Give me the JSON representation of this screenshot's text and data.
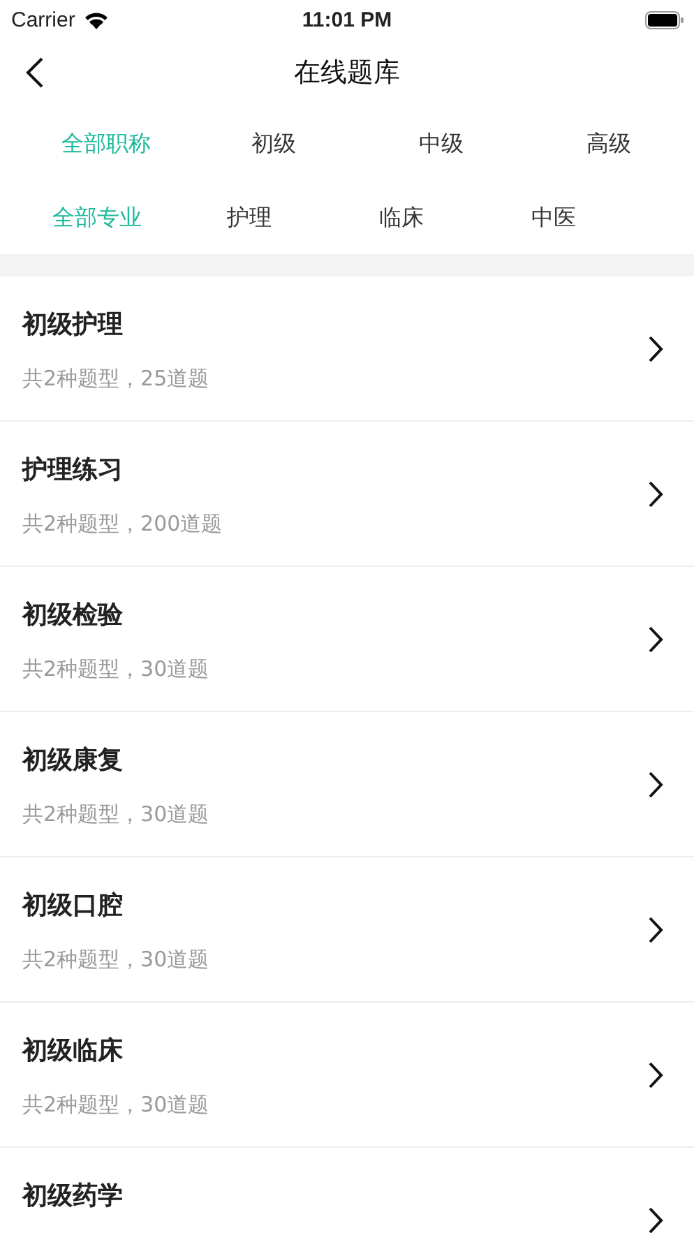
{
  "status_bar": {
    "carrier": "Carrier",
    "time": "11:01 PM"
  },
  "nav": {
    "title": "在线题库"
  },
  "level_tabs": [
    {
      "label": "全部职称",
      "selected": true
    },
    {
      "label": "初级",
      "selected": false
    },
    {
      "label": "中级",
      "selected": false
    },
    {
      "label": "高级",
      "selected": false
    }
  ],
  "major_tabs": [
    {
      "label": "全部专业",
      "selected": true
    },
    {
      "label": "护理",
      "selected": false
    },
    {
      "label": "临床",
      "selected": false
    },
    {
      "label": "中医",
      "selected": false
    }
  ],
  "banks": [
    {
      "title": "初级护理",
      "subtitle": "共2种题型，25道题"
    },
    {
      "title": "护理练习",
      "subtitle": "共2种题型，200道题"
    },
    {
      "title": "初级检验",
      "subtitle": "共2种题型，30道题"
    },
    {
      "title": "初级康复",
      "subtitle": "共2种题型，30道题"
    },
    {
      "title": "初级口腔",
      "subtitle": "共2种题型，30道题"
    },
    {
      "title": "初级临床",
      "subtitle": "共2种题型，30道题"
    },
    {
      "title": "初级药学"
    }
  ]
}
